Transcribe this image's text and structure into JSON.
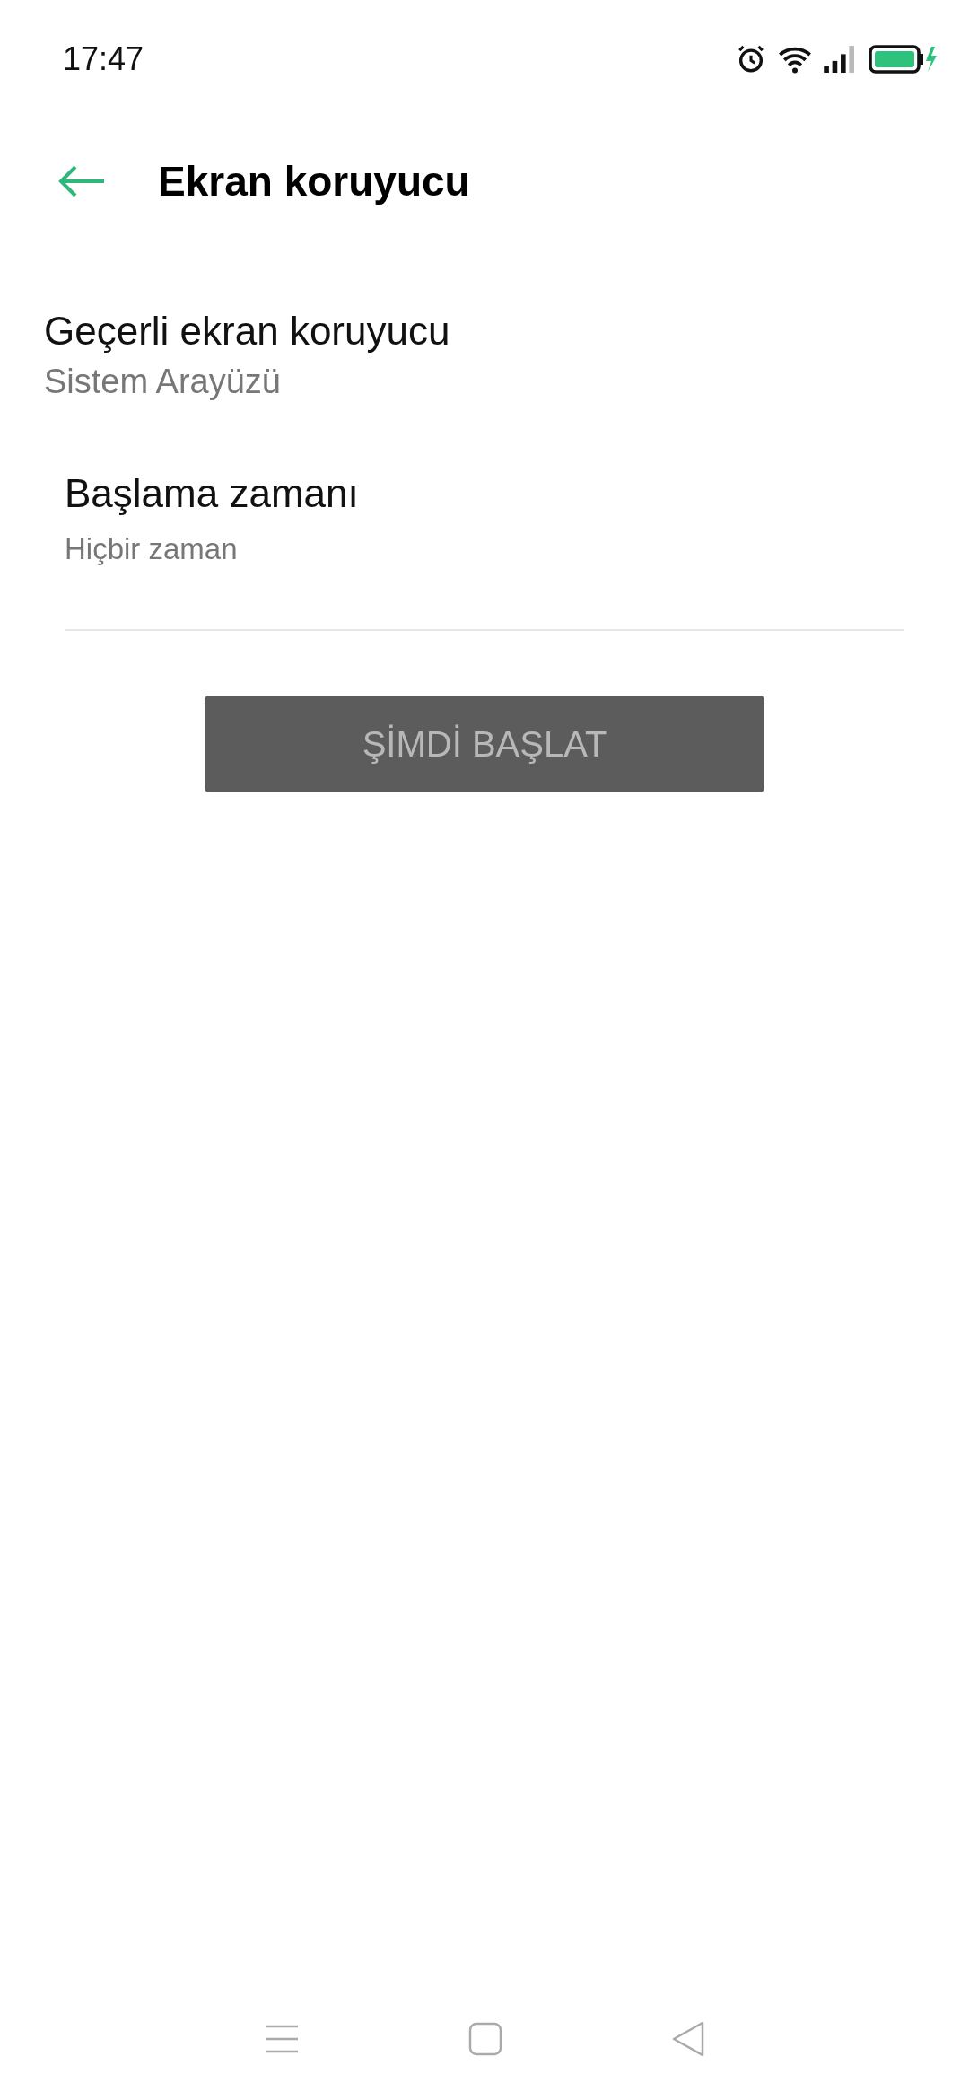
{
  "status_bar": {
    "time": "17:47"
  },
  "header": {
    "title": "Ekran koruyucu"
  },
  "settings": [
    {
      "kind": "plain",
      "title": "Geçerli ekran koruyucu",
      "summary": "Sistem Arayüzü"
    },
    {
      "kind": "indented",
      "title": "Başlama zamanı",
      "summary": "Hiçbir zaman"
    }
  ],
  "action_button": {
    "label": "ŞİMDİ BAŞLAT",
    "disabled": true
  }
}
